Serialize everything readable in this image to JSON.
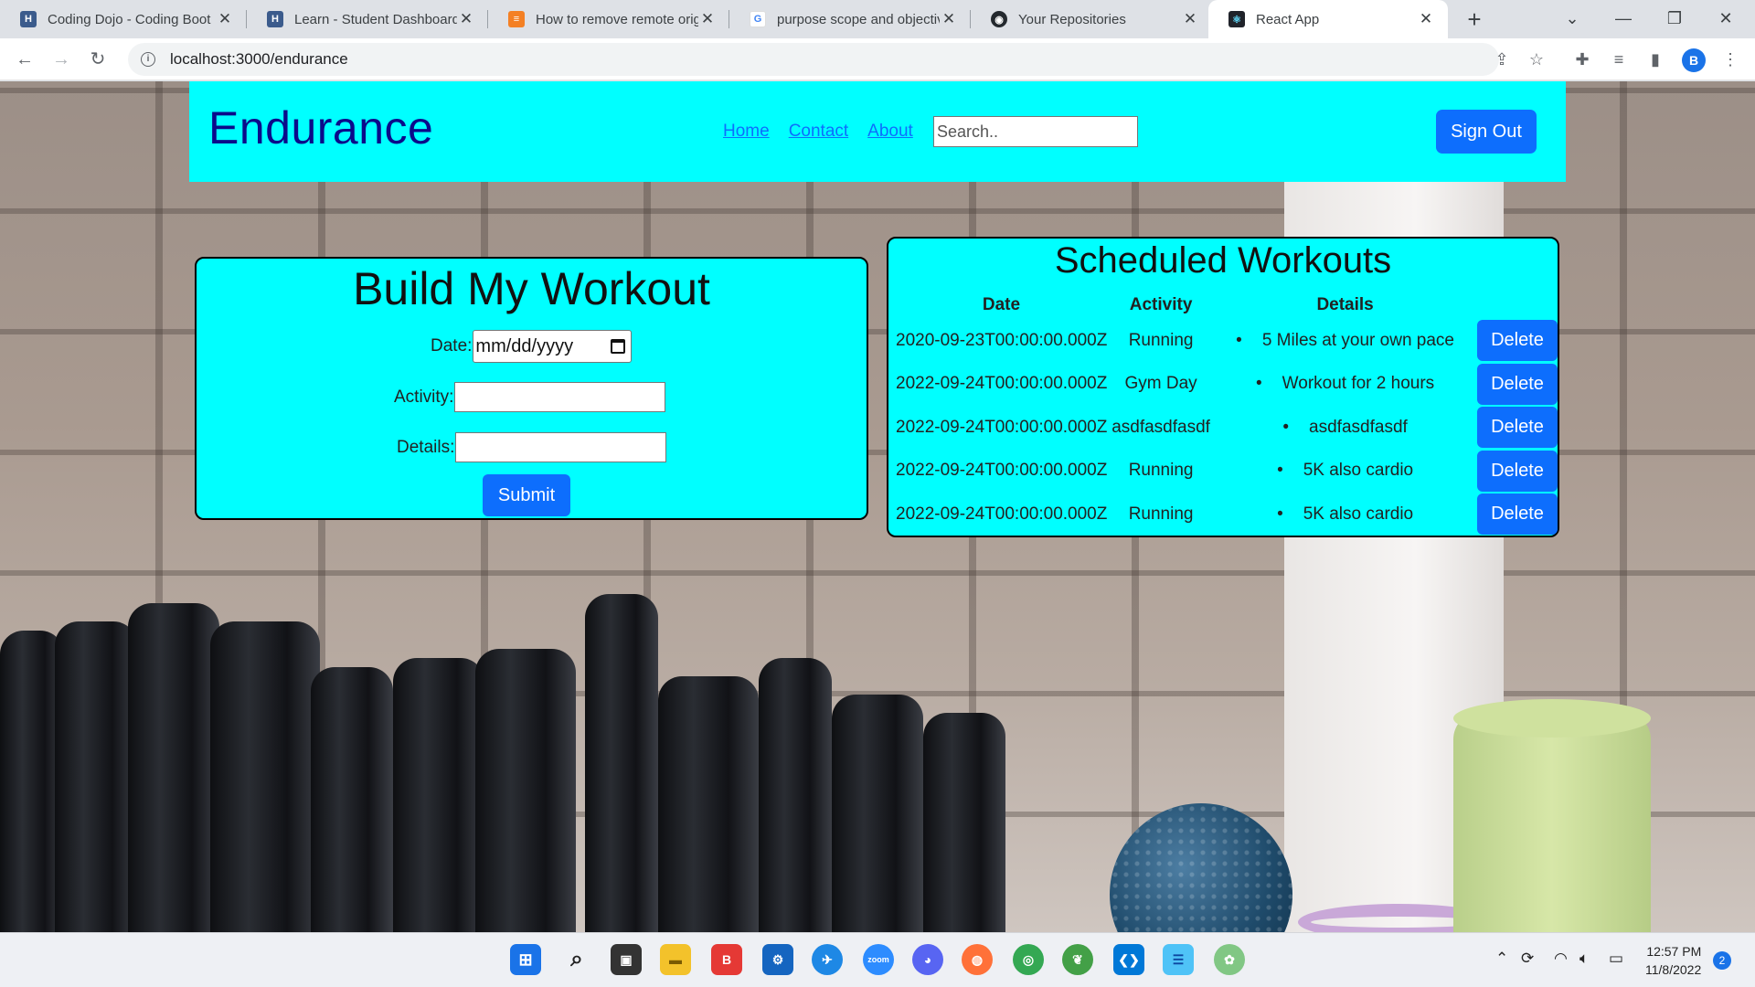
{
  "browser": {
    "tabs": [
      {
        "title": "Coding Dojo - Coding Boot",
        "icon": "coding-dojo-icon",
        "active": false
      },
      {
        "title": "Learn - Student Dashboard",
        "icon": "coding-dojo-icon",
        "active": false
      },
      {
        "title": "How to remove remote orig",
        "icon": "stackoverflow-icon",
        "active": false
      },
      {
        "title": "purpose scope and objectiv",
        "icon": "google-icon",
        "active": false
      },
      {
        "title": "Your Repositories",
        "icon": "github-icon",
        "active": false
      },
      {
        "title": "React App",
        "icon": "react-icon",
        "active": true
      }
    ],
    "url": "localhost:3000/endurance",
    "profile_initial": "B"
  },
  "navbar": {
    "brand": "Endurance",
    "links": [
      "Home",
      "Contact",
      "About"
    ],
    "search_placeholder": "Search..",
    "signout_label": "Sign Out"
  },
  "build_form": {
    "title": "Build My Workout",
    "date_label": "Date:",
    "date_placeholder": "mm/dd/yyyy",
    "activity_label": "Activity:",
    "activity_value": "",
    "details_label": "Details:",
    "details_value": "",
    "submit_label": "Submit"
  },
  "schedule": {
    "title": "Scheduled Workouts",
    "headers": [
      "Date",
      "Activity",
      "Details"
    ],
    "delete_label": "Delete",
    "rows": [
      {
        "date": "2020-09-23T00:00:00.000Z",
        "activity": "Running",
        "details": "5 Miles at your own pace"
      },
      {
        "date": "2022-09-24T00:00:00.000Z",
        "activity": "Gym Day",
        "details": "Workout for 2 hours"
      },
      {
        "date": "2022-09-24T00:00:00.000Z",
        "activity": "asdfasdfasdf",
        "details": "asdfasdfasdf"
      },
      {
        "date": "2022-09-24T00:00:00.000Z",
        "activity": "Running",
        "details": "5K also cardio"
      },
      {
        "date": "2022-09-24T00:00:00.000Z",
        "activity": "Running",
        "details": "5K also cardio"
      }
    ]
  },
  "taskbar": {
    "time": "12:57 PM",
    "date": "11/8/2022",
    "notification_count": "2"
  },
  "colors": {
    "accent_cyan": "#00ffff",
    "brand_navy": "#0b0b8a",
    "button_blue": "#0d6efd"
  }
}
